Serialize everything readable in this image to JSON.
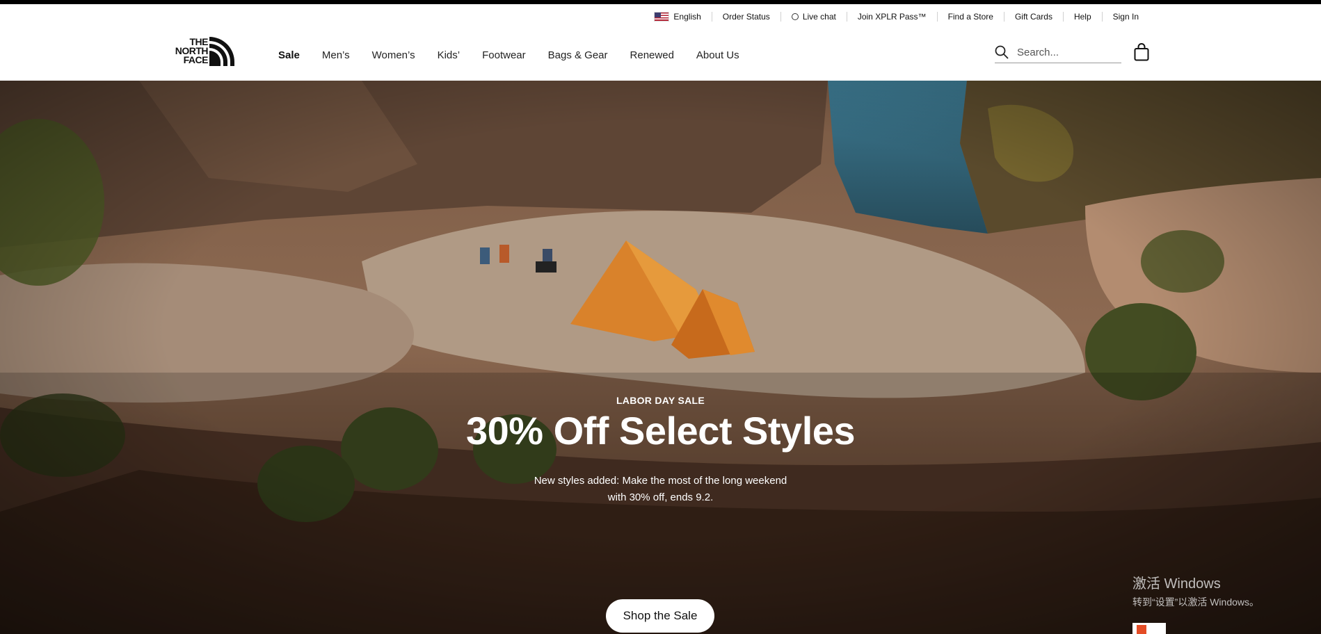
{
  "utility": {
    "language": "English",
    "order_status": "Order Status",
    "live_chat": "Live chat",
    "xplr": "Join XPLR Pass™",
    "find_store": "Find a Store",
    "gift_cards": "Gift Cards",
    "help": "Help",
    "sign_in": "Sign In"
  },
  "logo": {
    "line1": "THE",
    "line2": "NORTH",
    "line3": "FACE"
  },
  "nav": {
    "items": [
      "Sale",
      "Men’s",
      "Women’s",
      "Kids’",
      "Footwear",
      "Bags & Gear",
      "Renewed",
      "About Us"
    ]
  },
  "search": {
    "placeholder": "Search..."
  },
  "hero": {
    "eyebrow": "LABOR DAY SALE",
    "headline": "30% Off Select Styles",
    "sub_line1": "New styles added: Make the most of the long weekend",
    "sub_line2": "with 30% off, ends 9.2.",
    "cta": "Shop the Sale"
  },
  "watermark": {
    "line1": "激活 Windows",
    "line2": "转到“设置”以激活 Windows。"
  },
  "colors": {
    "tent": "#d9822b",
    "river": "#2f5f73",
    "rock": "#6b4a35"
  }
}
